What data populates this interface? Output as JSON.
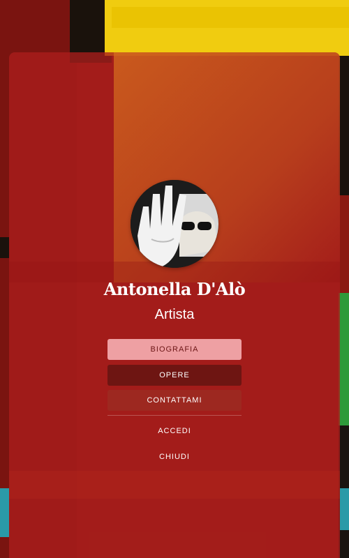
{
  "profile": {
    "name": "Antonella D'Alò",
    "subtitle": "Artista"
  },
  "menu": {
    "items": [
      {
        "label": "BIOGRAFIA"
      },
      {
        "label": "OPERE"
      },
      {
        "label": "CONTATTAMI"
      }
    ],
    "links": [
      {
        "label": "ACCEDI"
      },
      {
        "label": "CHIUDI"
      }
    ]
  },
  "colors": {
    "panel": "#aa1e1c",
    "bio_button": "#eea0a3",
    "opere_button": "#6e1512",
    "contact_button": "#9d2820",
    "background_yellow": "#f0cc10",
    "background_green": "#2e9a3a",
    "background_teal": "#2a9aa8"
  }
}
